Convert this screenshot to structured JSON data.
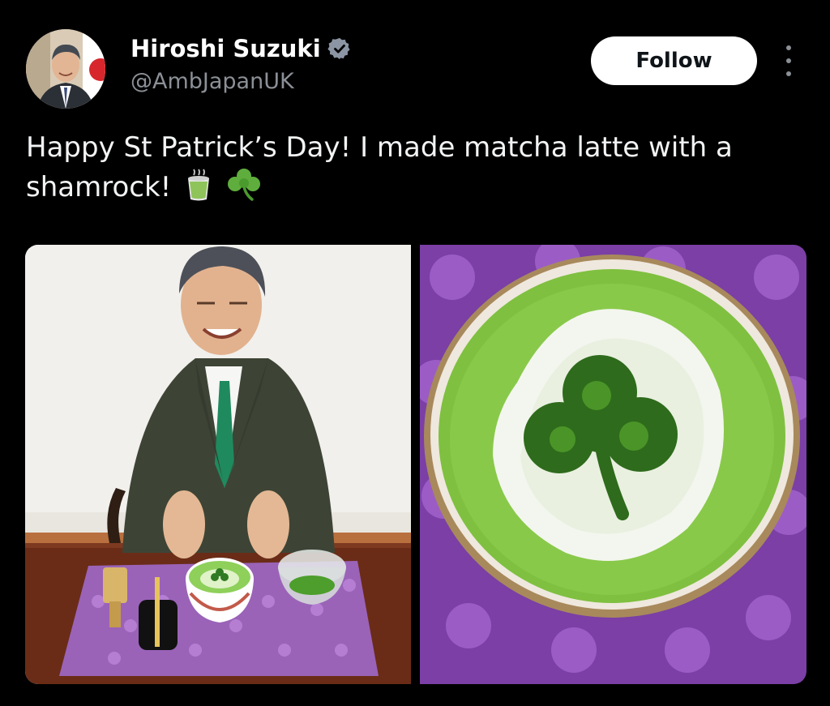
{
  "author": {
    "name": "Hiroshi Suzuki",
    "handle": "@AmbJapanUK",
    "verified_icon": "verified-badge-icon",
    "avatar": "avatar-photo"
  },
  "actions": {
    "follow_label": "Follow",
    "more_icon": "more-options-icon"
  },
  "tweet": {
    "text": "Happy St Patrick’s Day! I made matcha latte with a shamrock!",
    "emojis": [
      "matcha-tea-icon",
      "shamrock-icon"
    ]
  },
  "media": {
    "images": [
      {
        "name": "ambassador-with-matcha-photo"
      },
      {
        "name": "matcha-latte-shamrock-photo"
      }
    ]
  },
  "colors": {
    "background": "#000000",
    "text": "#e7e9ea",
    "secondary_text": "#8b9096",
    "verified": "#8b95a3",
    "follow_bg": "#ffffff"
  }
}
